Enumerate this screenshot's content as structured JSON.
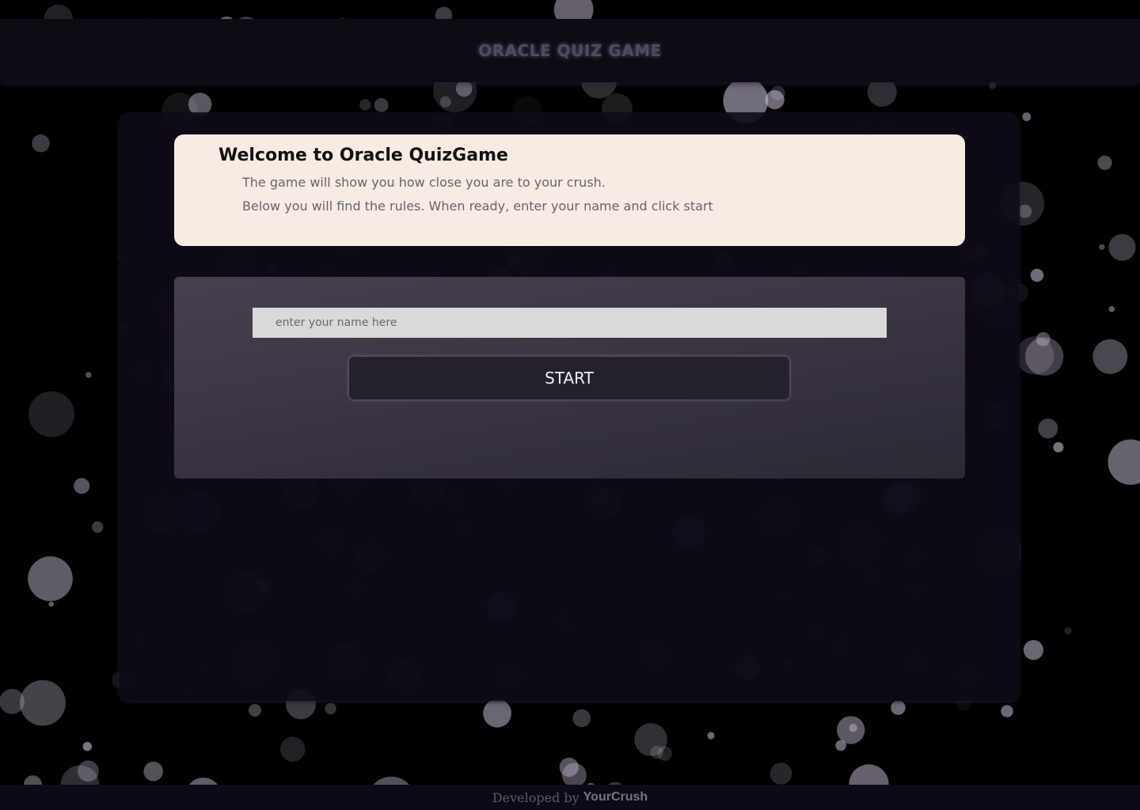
{
  "header": {
    "title": "ORACLE QUIZ GAME"
  },
  "welcome": {
    "title": "Welcome to Oracle QuizGame",
    "line1": "The game will show you how close you are to your crush.",
    "line2": "Below you will find the rules. When ready, enter your name and click start"
  },
  "form": {
    "name_value": "",
    "name_placeholder": "enter your name here",
    "start_label": "START"
  },
  "footer": {
    "prefix": "Developed by",
    "brand": "YourCrush"
  },
  "colors": {
    "background": "#000000",
    "header_bg": "#0d0b14",
    "panel_bg": "#0e0b18",
    "welcome_card_bg": "#f7ebe3",
    "form_card_bg": "#3b3544",
    "input_bg": "#d9d9d9",
    "button_bg": "#24212c",
    "bubble": "#c9c0d8"
  }
}
